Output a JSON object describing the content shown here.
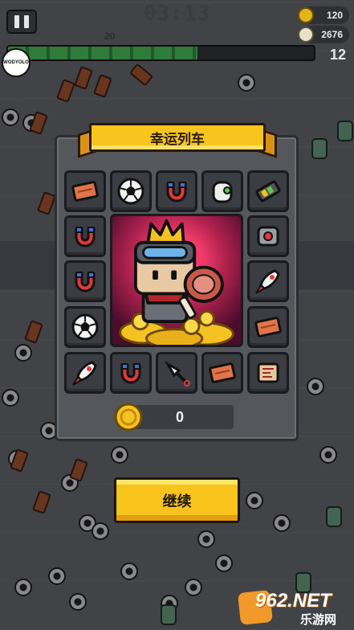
{
  "hud": {
    "timer": "03:13",
    "kills_small": "20",
    "gold": "120",
    "skulls": "2676",
    "level": "12",
    "avatar_text": "WODYOLO",
    "xp_progress": 0.62
  },
  "modal": {
    "title": "幸运列车",
    "coins_value": "0",
    "continue_label": "继续"
  },
  "slots": [
    {
      "icon": "brick-icon"
    },
    {
      "icon": "soccer-ball-icon"
    },
    {
      "icon": "magnet-icon"
    },
    {
      "icon": "drone-icon"
    },
    {
      "icon": "battery-icon"
    },
    {
      "icon": "magnet-icon"
    },
    {
      "icon": "robot-core-icon"
    },
    {
      "icon": "magnet-icon"
    },
    {
      "icon": "rocket-icon"
    },
    {
      "icon": "soccer-ball-icon"
    },
    {
      "icon": "brick-icon"
    },
    {
      "icon": "rocket-icon"
    },
    {
      "icon": "magnet-icon"
    },
    {
      "icon": "kunai-icon"
    },
    {
      "icon": "brick-icon"
    },
    {
      "icon": "map-scroll-icon"
    }
  ],
  "watermark": {
    "number": "962",
    "suffix": ".NET",
    "label": "乐游网"
  },
  "colors": {
    "accent_yellow": "#f8c31a",
    "panel": "#54575c",
    "slot": "#3a3d42",
    "xp_green": "#2f7b3a"
  }
}
